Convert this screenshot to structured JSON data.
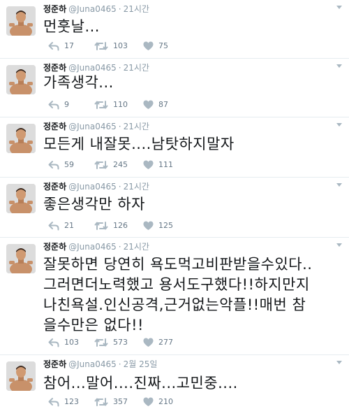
{
  "tweets": [
    {
      "name": "정준하",
      "handle": "@Juna0465",
      "time": "21시간",
      "text": "먼훗날...",
      "replies": "17",
      "retweets": "103",
      "likes": "75"
    },
    {
      "name": "정준하",
      "handle": "@Juna0465",
      "time": "21시간",
      "text": "가족생각...",
      "replies": "9",
      "retweets": "110",
      "likes": "87"
    },
    {
      "name": "정준하",
      "handle": "@Juna0465",
      "time": "21시간",
      "text": "모든게 내잘못....남탓하지말자",
      "replies": "59",
      "retweets": "245",
      "likes": "111"
    },
    {
      "name": "정준하",
      "handle": "@Juna0465",
      "time": "21시간",
      "text": "좋은생각만 하자",
      "replies": "21",
      "retweets": "126",
      "likes": "125"
    },
    {
      "name": "정준하",
      "handle": "@Juna0465",
      "time": "21시간",
      "text": "잘못하면 당연히 욕도먹고비판받을수있다..\n그러면더노력했고 용서도구했다!!하지만지\n나친욕설.인신공격,근거없는악플!!매번 참\n을수만은 없다!!",
      "replies": "103",
      "retweets": "573",
      "likes": "277"
    },
    {
      "name": "정준하",
      "handle": "@Juna0465",
      "time": "2월 25일",
      "text": "참어...말어....진짜...고민중....",
      "replies": "123",
      "retweets": "357",
      "likes": "210"
    }
  ],
  "separator": "·",
  "icons": {
    "reply": "reply-icon",
    "retweet": "retweet-icon",
    "like": "heart-icon",
    "more": "chevron-down-icon"
  },
  "colors": {
    "muted": "#8899a6",
    "action": "#657786",
    "icon": "#aab8c2",
    "divider": "#e6ecf0"
  }
}
